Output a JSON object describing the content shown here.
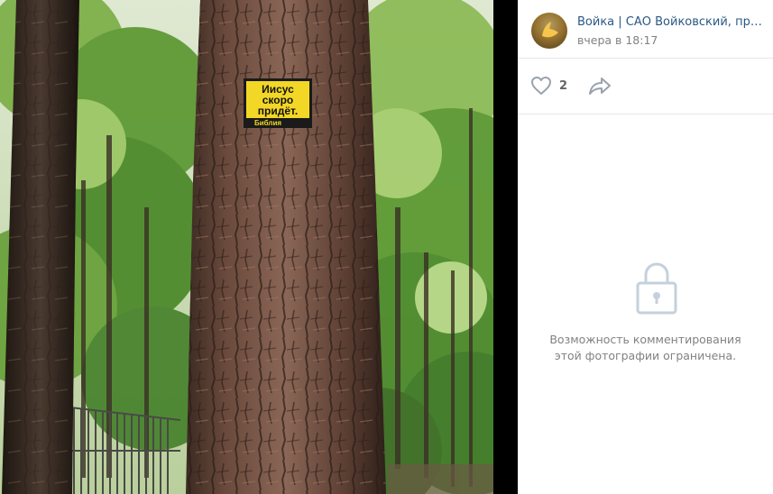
{
  "photo": {
    "sign": {
      "line1": "Иисус",
      "line2": "скоро",
      "line3": "придёт.",
      "line4": "Библия"
    }
  },
  "post": {
    "author": "Войка | САО Войковский, привива...",
    "date": "вчера в 18:17"
  },
  "actions": {
    "likes": "2",
    "like_icon": "heart-icon",
    "share_icon": "share-arrow-icon"
  },
  "comments": {
    "icon": "lock-icon",
    "restricted_text": "Возможность комментирования этой фотографии ограничена."
  },
  "colors": {
    "link": "#2a5885",
    "muted": "#828282",
    "icon": "#99a2ad",
    "divider": "#e7e8ec"
  }
}
